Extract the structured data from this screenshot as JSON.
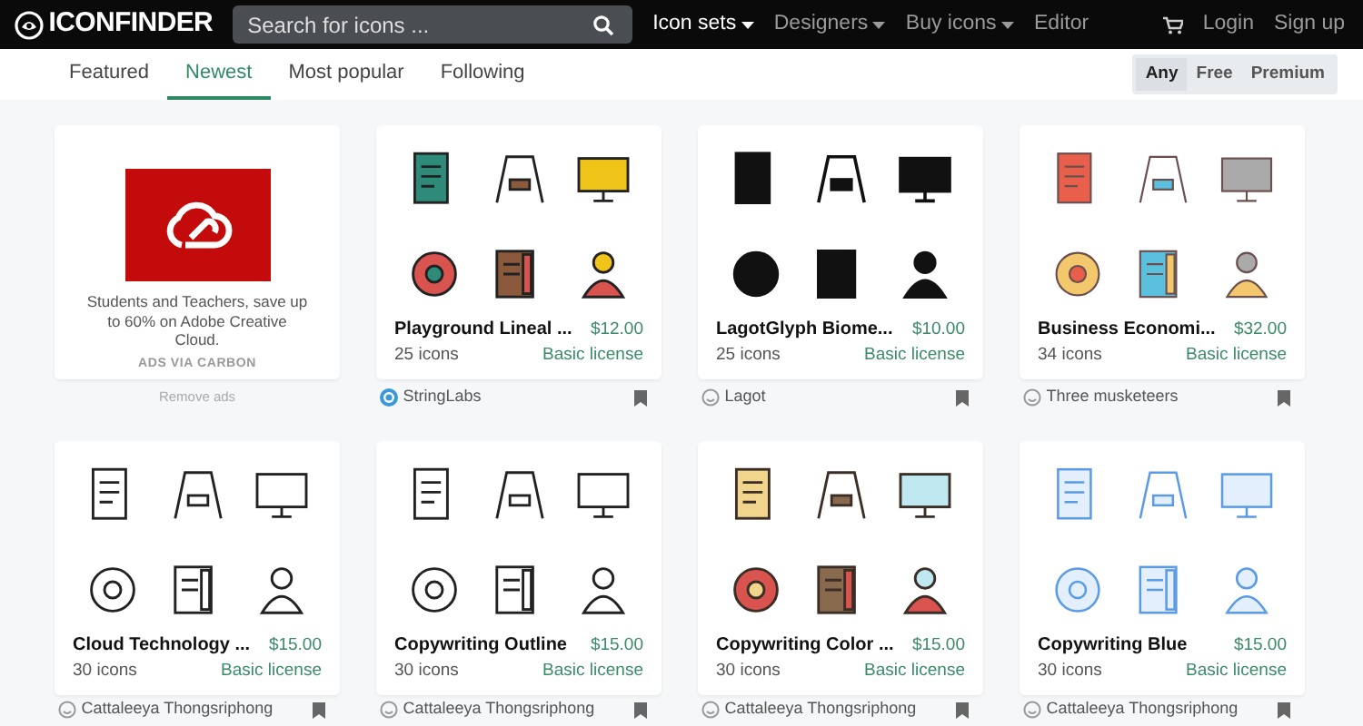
{
  "navbar": {
    "logo": "ICONFINDER",
    "search": {
      "placeholder": "Search for icons ..."
    },
    "menu": [
      {
        "label": "Icon sets",
        "dropdown": true,
        "selected": true
      },
      {
        "label": "Designers",
        "dropdown": true,
        "selected": false
      },
      {
        "label": "Buy icons",
        "dropdown": true,
        "selected": false
      },
      {
        "label": "Editor",
        "dropdown": false,
        "selected": false
      }
    ],
    "links": [
      "Login",
      "Sign up"
    ]
  },
  "tabs": [
    {
      "label": "Featured",
      "selected": false
    },
    {
      "label": "Newest",
      "selected": true
    },
    {
      "label": "Most popular",
      "selected": false
    },
    {
      "label": "Following",
      "selected": false
    }
  ],
  "license_filter": [
    {
      "label": "Any",
      "selected": true
    },
    {
      "label": "Free",
      "selected": false
    },
    {
      "label": "Premium",
      "selected": false
    }
  ],
  "ad": {
    "text": "Students and Teachers, save up to 60% on Adobe Creative Cloud.",
    "source": "ADS VIA CARBON",
    "remove": "Remove ads"
  },
  "icon_sets": [
    {
      "title": "Playground Lineal ...",
      "price": "$12.00",
      "count": "25 icons",
      "license": "Basic license",
      "author": "StringLabs",
      "kind": "lineal"
    },
    {
      "title": "LagotGlyph Biome...",
      "price": "$10.00",
      "count": "25 icons",
      "license": "Basic license",
      "author": "Lagot",
      "kind": "glyph"
    },
    {
      "title": "Business Economi...",
      "price": "$32.00",
      "count": "34 icons",
      "license": "Basic license",
      "author": "Three musketeers",
      "kind": "flat"
    },
    {
      "title": "Cloud Technology ...",
      "price": "$15.00",
      "count": "30 icons",
      "license": "Basic license",
      "author": "Cattaleeya Thongsriphong",
      "kind": "outline"
    },
    {
      "title": "Copywriting Outline",
      "price": "$15.00",
      "count": "30 icons",
      "license": "Basic license",
      "author": "Cattaleeya Thongsriphong",
      "kind": "outline"
    },
    {
      "title": "Copywriting Color ...",
      "price": "$15.00",
      "count": "30 icons",
      "license": "Basic license",
      "author": "Cattaleeya Thongsriphong",
      "kind": "filled"
    },
    {
      "title": "Copywriting Blue",
      "price": "$15.00",
      "count": "30 icons",
      "license": "Basic license",
      "author": "Cattaleeya Thongsriphong",
      "kind": "blue"
    }
  ]
}
